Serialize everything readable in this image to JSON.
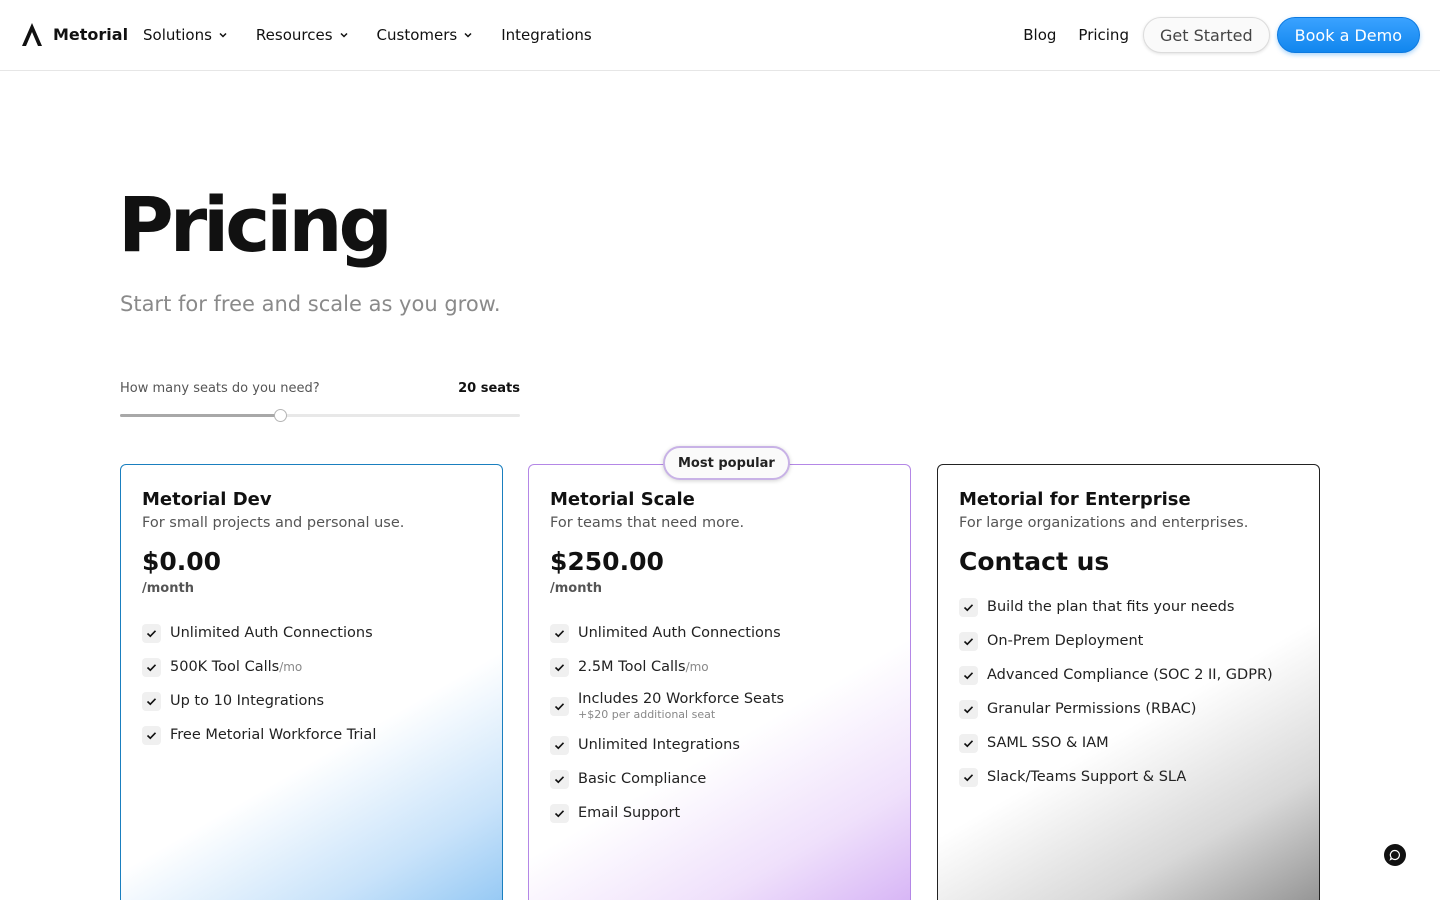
{
  "header": {
    "brand": "Metorial",
    "nav": [
      {
        "label": "Solutions",
        "has_dropdown": true
      },
      {
        "label": "Resources",
        "has_dropdown": true
      },
      {
        "label": "Customers",
        "has_dropdown": true
      },
      {
        "label": "Integrations",
        "has_dropdown": false
      }
    ],
    "links": {
      "blog": "Blog",
      "pricing": "Pricing"
    },
    "get_started": "Get Started",
    "book_demo": "Book a Demo"
  },
  "hero": {
    "title": "Pricing",
    "subtitle": "Start for free and scale as you grow."
  },
  "seats": {
    "label": "How many seats do you need?",
    "value_text": "20 seats",
    "fraction": 0.4
  },
  "plans": {
    "dev": {
      "name": "Metorial Dev",
      "desc": "For small projects and personal use.",
      "price": "$0.00",
      "period": "/month",
      "features": [
        {
          "text": "Unlimited Auth Connections"
        },
        {
          "text": "500K Tool Calls",
          "suffix": "/mo"
        },
        {
          "text": "Up to 10 Integrations"
        },
        {
          "text": "Free Metorial Workforce Trial"
        }
      ]
    },
    "scale": {
      "badge": "Most popular",
      "name": "Metorial Scale",
      "desc": "For teams that need more.",
      "price": "$250.00",
      "period": "/month",
      "features": [
        {
          "text": "Unlimited Auth Connections"
        },
        {
          "text": "2.5M Tool Calls",
          "suffix": "/mo"
        },
        {
          "text": "Includes 20 Workforce Seats",
          "sub": "+$20 per additional seat"
        },
        {
          "text": "Unlimited Integrations"
        },
        {
          "text": "Basic Compliance"
        },
        {
          "text": "Email Support"
        }
      ]
    },
    "enterprise": {
      "name": "Metorial for Enterprise",
      "desc": "For large organizations and enterprises.",
      "cta": "Contact us",
      "features": [
        {
          "text": "Build the plan that fits your needs"
        },
        {
          "text": "On-Prem Deployment"
        },
        {
          "text": "Advanced Compliance (SOC 2 II, GDPR)"
        },
        {
          "text": "Granular Permissions (RBAC)"
        },
        {
          "text": "SAML SSO & IAM"
        },
        {
          "text": "Slack/Teams Support & SLA"
        }
      ]
    }
  },
  "colors": {
    "primary": "#1186ee",
    "dev_border": "#1a7fbf",
    "scale_border": "#b487e6",
    "enterprise_border": "#222222"
  },
  "icons": {
    "logo": "metorial-logo-icon",
    "dropdown": "chevron-down-icon",
    "feature": "check-icon",
    "chat": "chat-bubble-icon"
  }
}
